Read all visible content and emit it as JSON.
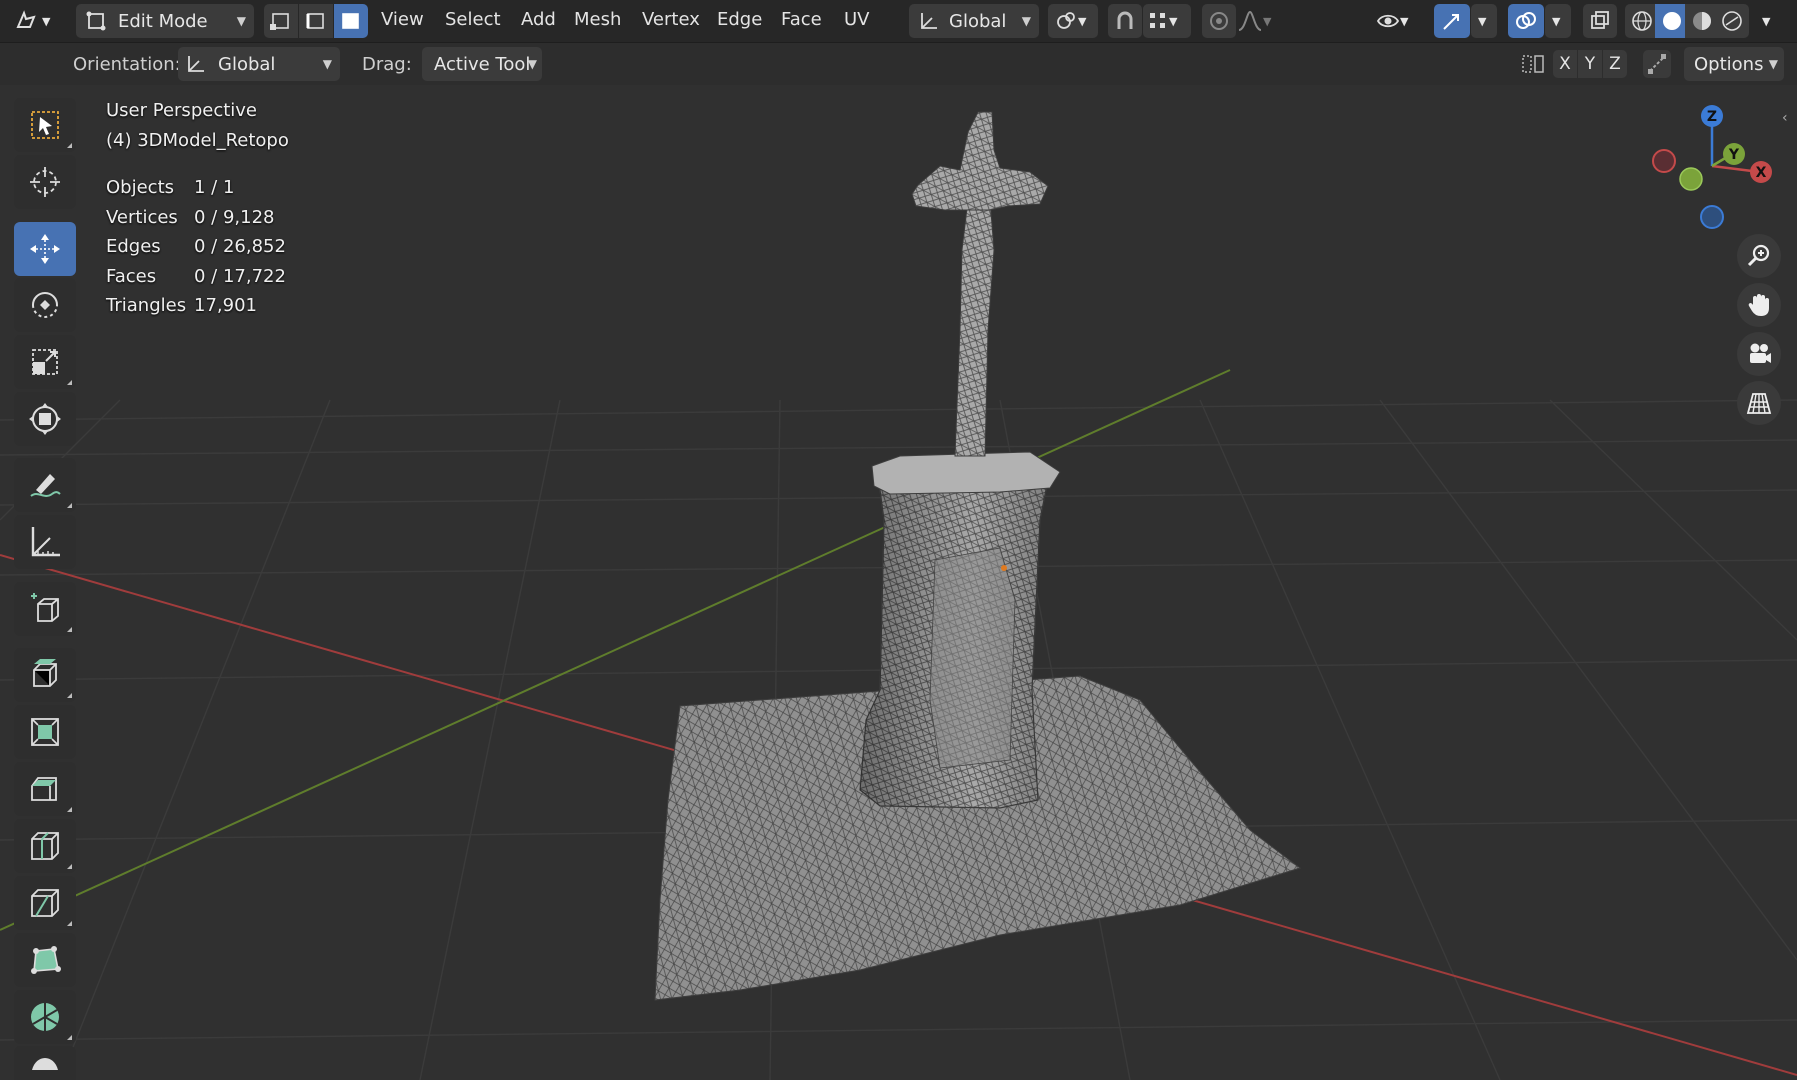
{
  "header": {
    "mode_label": "Edit Mode",
    "menus": [
      "View",
      "Select",
      "Add",
      "Mesh",
      "Vertex",
      "Edge",
      "Face",
      "UV"
    ],
    "transform_orientation": "Global"
  },
  "tool_header": {
    "orientation_label": "Orientation:",
    "orientation_value": "Global",
    "drag_label": "Drag:",
    "drag_value": "Active Tool",
    "axes": [
      "X",
      "Y",
      "Z"
    ],
    "options_label": "Options"
  },
  "viewport": {
    "view_name": "User Perspective",
    "object_name": "(4) 3DModel_Retopo",
    "stats": [
      {
        "label": "Objects",
        "value": "1 / 1"
      },
      {
        "label": "Vertices",
        "value": "0 / 9,128"
      },
      {
        "label": "Edges",
        "value": "0 / 26,852"
      },
      {
        "label": "Faces",
        "value": "0 / 17,722"
      },
      {
        "label": "Triangles",
        "value": "17,901"
      }
    ]
  },
  "gizmo": {
    "x": "X",
    "y": "Y",
    "z": "Z"
  },
  "toolbar": {
    "tools": [
      "select-box",
      "cursor",
      "move",
      "rotate",
      "scale",
      "transform",
      "annotate",
      "measure",
      "add-cube",
      "extrude-region",
      "inset-faces",
      "bevel",
      "loop-cut",
      "knife",
      "poly-build",
      "spin",
      "smooth"
    ],
    "active_tool": "move"
  },
  "colors": {
    "accent": "#4772b3",
    "x_axis": "#c44a4a",
    "y_axis": "#7ba33a",
    "z_axis": "#3b7bd6",
    "background": "#303030"
  }
}
